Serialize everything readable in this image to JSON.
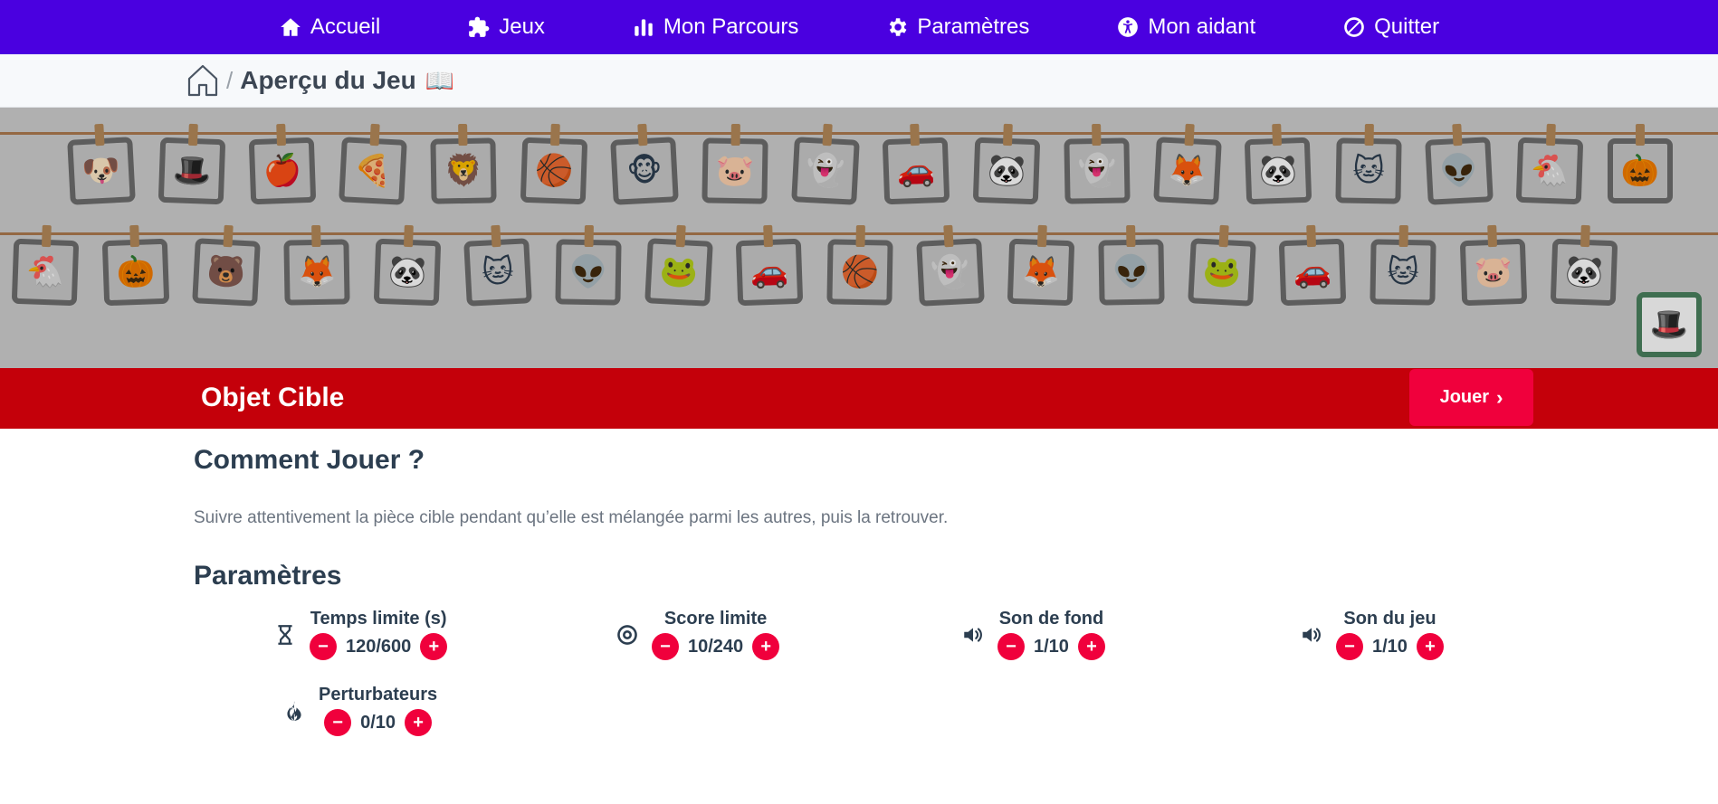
{
  "nav": {
    "items": [
      {
        "label": "Accueil",
        "icon": "home-icon"
      },
      {
        "label": "Jeux",
        "icon": "puzzle-icon"
      },
      {
        "label": "Mon Parcours",
        "icon": "bar-chart-icon"
      },
      {
        "label": "Paramètres",
        "icon": "gear-icon"
      },
      {
        "label": "Mon aidant",
        "icon": "accessibility-icon"
      },
      {
        "label": "Quitter",
        "icon": "ban-icon"
      }
    ]
  },
  "breadcrumb": {
    "separator": "/",
    "title": "Aperçu du Jeu",
    "title_emoji": "📖"
  },
  "preview": {
    "row1": [
      "🐶",
      "🎩",
      "🍎",
      "🍕",
      "🦁",
      "🏀",
      "🐵",
      "🐷",
      "👻",
      "🚗",
      "🐼",
      "👻",
      "🦊",
      "🐼",
      "🐱",
      "👽",
      "🐔",
      "🎃"
    ],
    "row2": [
      "🐔",
      "🎃",
      "🐻",
      "🦊",
      "🐼",
      "🐱",
      "👽",
      "🐸",
      "🚗",
      "🏀",
      "👻",
      "🦊",
      "👽",
      "🐸",
      "🚗",
      "🐱",
      "🐷",
      "🐼"
    ],
    "target": "🎩"
  },
  "game": {
    "title": "Objet Cible",
    "play_label": "Jouer",
    "play_chevron": "›"
  },
  "how": {
    "title": "Comment Jouer ?",
    "text": "Suivre attentivement la pièce cible pendant qu’elle est mélangée parmi les autres, puis la retrouver."
  },
  "params": {
    "title": "Paramètres",
    "items": [
      {
        "label": "Temps limite (s)",
        "value": "120/600",
        "icon": "hourglass-icon"
      },
      {
        "label": "Score limite",
        "value": "10/240",
        "icon": "target-icon"
      },
      {
        "label": "Son de fond",
        "value": "1/10",
        "icon": "volume-icon"
      },
      {
        "label": "Son du jeu",
        "value": "1/10",
        "icon": "volume-icon"
      },
      {
        "label": "Perturbateurs",
        "value": "0/10",
        "icon": "fire-icon"
      }
    ],
    "minus": "−",
    "plus": "+"
  }
}
